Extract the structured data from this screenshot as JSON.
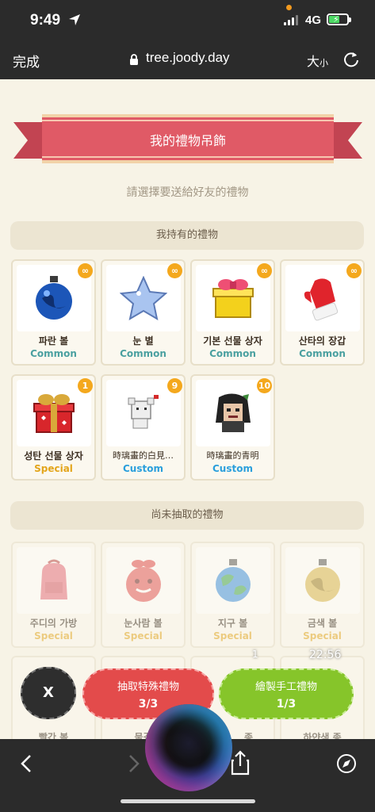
{
  "status_bar": {
    "time": "9:49",
    "network": "4G"
  },
  "browser": {
    "done_label": "完成",
    "url": "tree.joody.day",
    "font_size_big": "大",
    "font_size_small": "小"
  },
  "page": {
    "banner_title": "我的禮物吊飾",
    "subtitle": "請選擇要送給好友的禮物",
    "owned_section_title": "我持有的禮物",
    "owned": [
      {
        "name": "파란 볼",
        "rarity": "Common",
        "count": "∞",
        "icon": "blue-ornament-icon"
      },
      {
        "name": "눈 별",
        "rarity": "Common",
        "count": "∞",
        "icon": "star-icon"
      },
      {
        "name": "기본 선물 상자",
        "rarity": "Common",
        "count": "∞",
        "icon": "gift-box-icon"
      },
      {
        "name": "산타의 장갑",
        "rarity": "Common",
        "count": "∞",
        "icon": "mitten-icon"
      },
      {
        "name": "성탄 선물 상자",
        "rarity": "Special",
        "count": "1",
        "icon": "christmas-gift-icon"
      },
      {
        "name": "時璃畫的白見…",
        "rarity": "Custom",
        "count": "9",
        "icon": "pixel-mouse-drawing-icon"
      },
      {
        "name": "時璃畫的青明",
        "rarity": "Custom",
        "count": "10",
        "icon": "pixel-portrait-drawing-icon"
      }
    ],
    "locked_section_title": "尚未抽取的禮物",
    "locked": [
      {
        "name": "주디의 가방",
        "rarity": "Special",
        "icon": "backpack-icon"
      },
      {
        "name": "눈사람 볼",
        "rarity": "Special",
        "icon": "snowman-ornament-icon"
      },
      {
        "name": "지구 볼",
        "rarity": "Special",
        "icon": "earth-ornament-icon"
      },
      {
        "name": "금색 볼",
        "rarity": "Special",
        "icon": "gold-ornament-icon"
      }
    ],
    "locked_row2_partial": [
      "빨간 볼",
      "물결",
      "종",
      "하얀색 종"
    ]
  },
  "actions": {
    "close_label": "X",
    "draw_label": "抽取特殊禮物",
    "draw_count": "3/3",
    "craft_label": "繪製手工禮物",
    "craft_count": "1/3"
  },
  "overlay": {
    "one": "1",
    "time": "22:56"
  },
  "colors": {
    "banner": "#e05a66",
    "common": "#4aa0a0",
    "special": "#e3a51b",
    "custom": "#2a9fdc",
    "badge": "#f4a81d"
  }
}
